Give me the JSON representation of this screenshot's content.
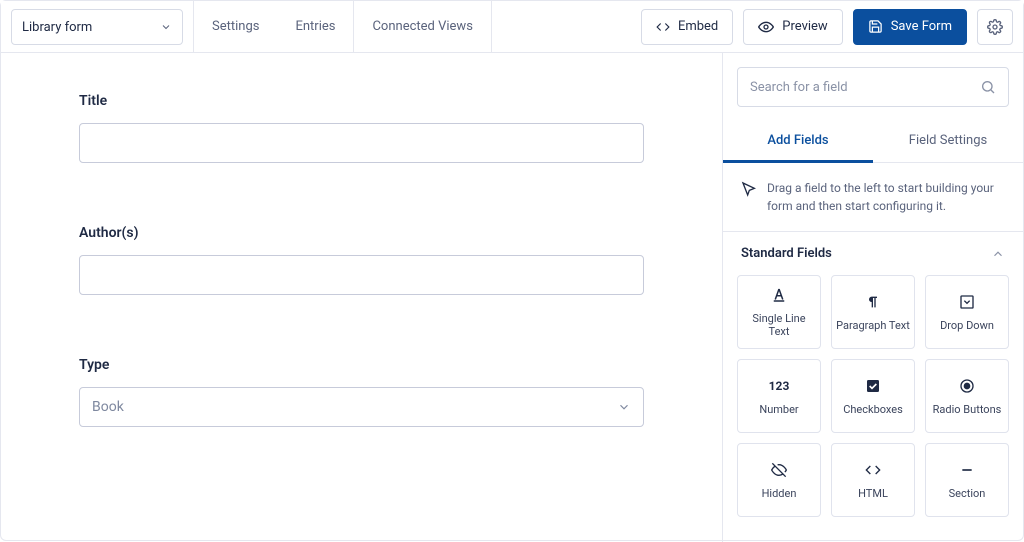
{
  "topbar": {
    "form_name": "Library form",
    "nav1": [
      "Settings",
      "Entries"
    ],
    "nav2": [
      "Connected Views"
    ],
    "embed": "Embed",
    "preview": "Preview",
    "save": "Save Form"
  },
  "canvas": {
    "fields": [
      {
        "label": "Title",
        "type": "text",
        "value": ""
      },
      {
        "label": "Author(s)",
        "type": "text",
        "value": ""
      },
      {
        "label": "Type",
        "type": "select",
        "value": "Book"
      }
    ]
  },
  "sidepanel": {
    "search_placeholder": "Search for a field",
    "tabs": {
      "add": "Add Fields",
      "settings": "Field Settings"
    },
    "hint": "Drag a field to the left to start building your form and then start configuring it.",
    "section_title": "Standard Fields",
    "tiles": [
      "Single Line Text",
      "Paragraph Text",
      "Drop Down",
      "Number",
      "Checkboxes",
      "Radio Buttons",
      "Hidden",
      "HTML",
      "Section"
    ]
  }
}
